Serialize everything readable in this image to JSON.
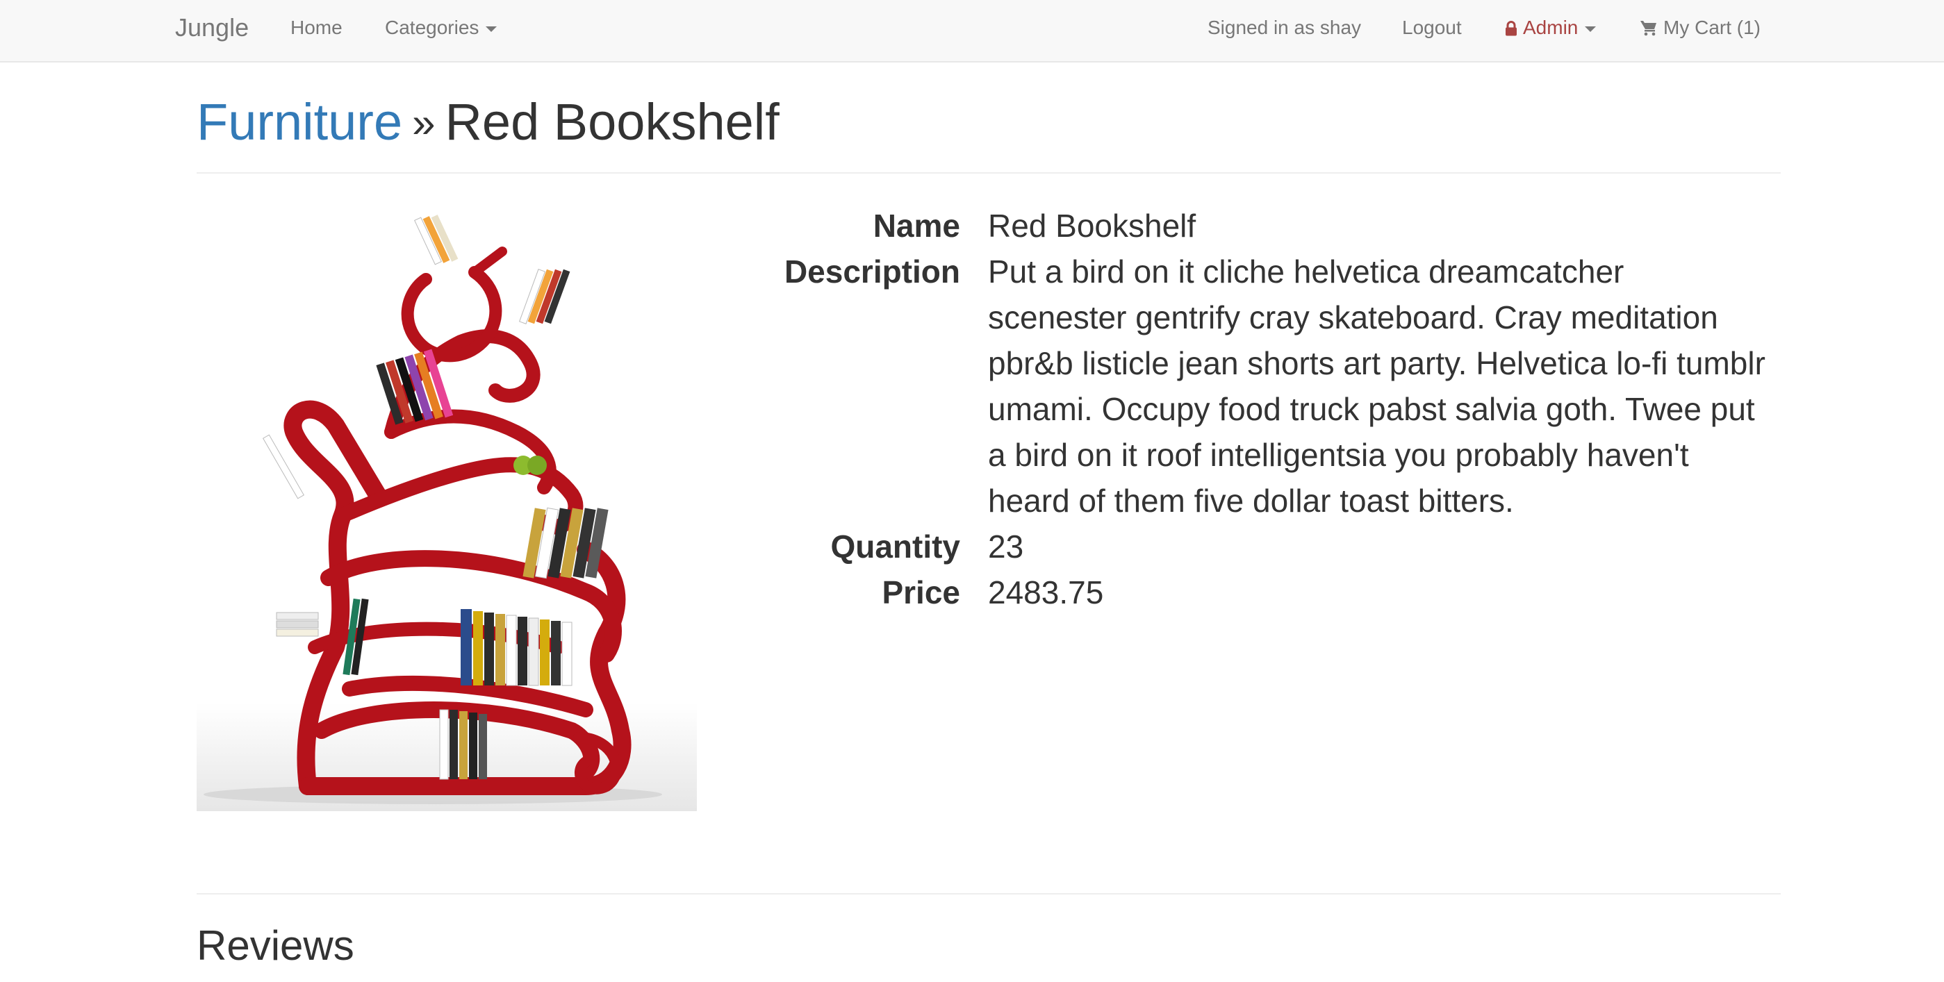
{
  "navbar": {
    "brand": "Jungle",
    "home": "Home",
    "categories": "Categories",
    "signed_in": "Signed in as shay",
    "logout": "Logout",
    "admin": "Admin",
    "cart": "My Cart (1)"
  },
  "breadcrumb": {
    "category": "Furniture",
    "separator": "»",
    "product": "Red Bookshelf"
  },
  "details": {
    "name_label": "Name",
    "name_value": "Red Bookshelf",
    "description_label": "Description",
    "description_value": "Put a bird on it cliche helvetica dreamcatcher scenester gentrify cray skateboard. Cray meditation pbr&b listicle jean shorts art party. Helvetica lo-fi tumblr umami. Occupy food truck pabst salvia goth. Twee put a bird on it roof intelligentsia you probably haven't heard of them five dollar toast bitters.",
    "quantity_label": "Quantity",
    "quantity_value": "23",
    "price_label": "Price",
    "price_value": "2483.75"
  },
  "reviews": {
    "title": "Reviews"
  },
  "colors": {
    "link": "#337ab7",
    "admin": "#a94442",
    "navbar_bg": "#f8f8f8",
    "shelf_red": "#b5121b"
  },
  "icons": {
    "lock": "lock-icon",
    "cart": "cart-icon",
    "caret": "chevron-down-icon"
  }
}
